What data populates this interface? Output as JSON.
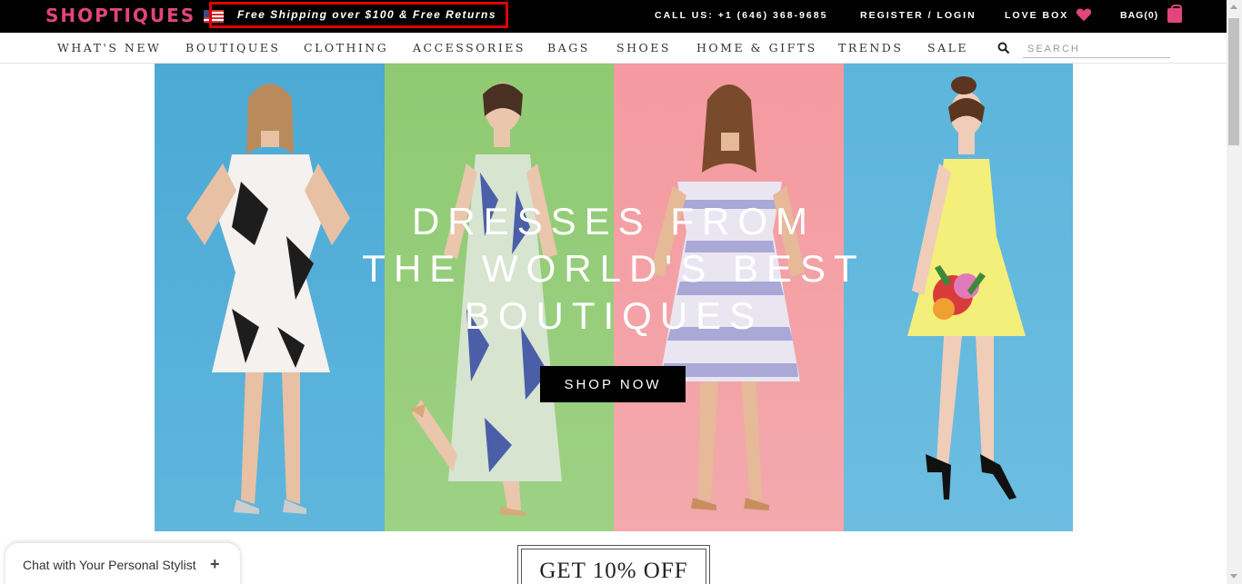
{
  "header": {
    "logo": "SHOPTIQUES",
    "promo": "Free Shipping over $100 & Free Returns",
    "call": "CALL US: +1 (646) 368-9685",
    "register": "REGISTER / LOGIN",
    "love_box": "LOVE BOX",
    "bag": "BAG(0)"
  },
  "nav": {
    "items": [
      "WHAT'S NEW",
      "BOUTIQUES",
      "CLOTHING",
      "ACCESSORIES",
      "BAGS",
      "SHOES",
      "HOME & GIFTS",
      "TRENDS",
      "SALE"
    ],
    "search_placeholder": "SEARCH"
  },
  "hero": {
    "title_line1": "DRESSES FROM",
    "title_line2": "THE WORLD'S BEST",
    "title_line3": "BOUTIQUES",
    "cta": "SHOP NOW"
  },
  "promo_box": {
    "text": "GET 10% OFF"
  },
  "chat": {
    "label": "Chat with Your Personal Stylist"
  },
  "colors": {
    "brand": "#e0457b",
    "topbar": "#000000",
    "highlight": "#e00000"
  },
  "icons": [
    "us-flag-icon",
    "heart-icon",
    "shopping-bag-icon",
    "search-icon",
    "plus-icon"
  ]
}
